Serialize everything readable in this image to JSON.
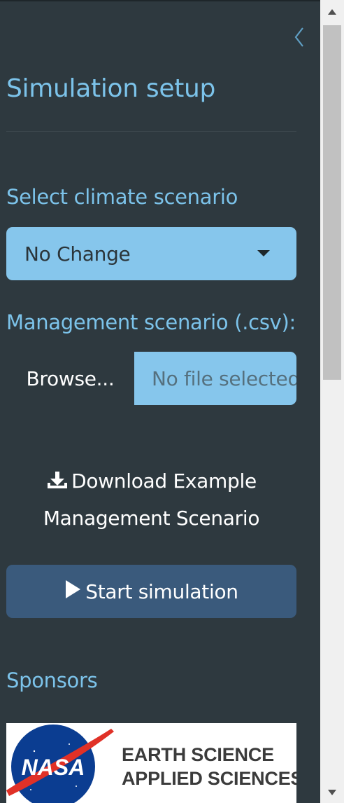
{
  "sidebar": {
    "title": "Simulation setup",
    "climate_label": "Select climate scenario",
    "climate_selected": "No Change",
    "management_label": "Management scenario (.csv):",
    "browse_label": "Browse...",
    "file_placeholder": "No file selected",
    "download_line1": "Download Example",
    "download_line2": "Management Scenario",
    "start_label": "Start simulation",
    "sponsors_label": "Sponsors",
    "sponsor_logo_text_line1": "EARTH SCIENCE",
    "sponsor_logo_text_line2": "APPLIED SCIENCES",
    "sponsor_logo_mark": "NASA"
  },
  "icons": {
    "collapse": "chevron-left-icon",
    "caret": "caret-down-icon",
    "download": "download-icon",
    "start": "play-icon"
  },
  "colors": {
    "panel_bg": "#2e393f",
    "accent_text": "#7cc3ea",
    "input_bg": "#86c6ec",
    "primary_button": "#3a5a7c"
  },
  "scrollbar": {
    "position_fraction": 0.0
  }
}
